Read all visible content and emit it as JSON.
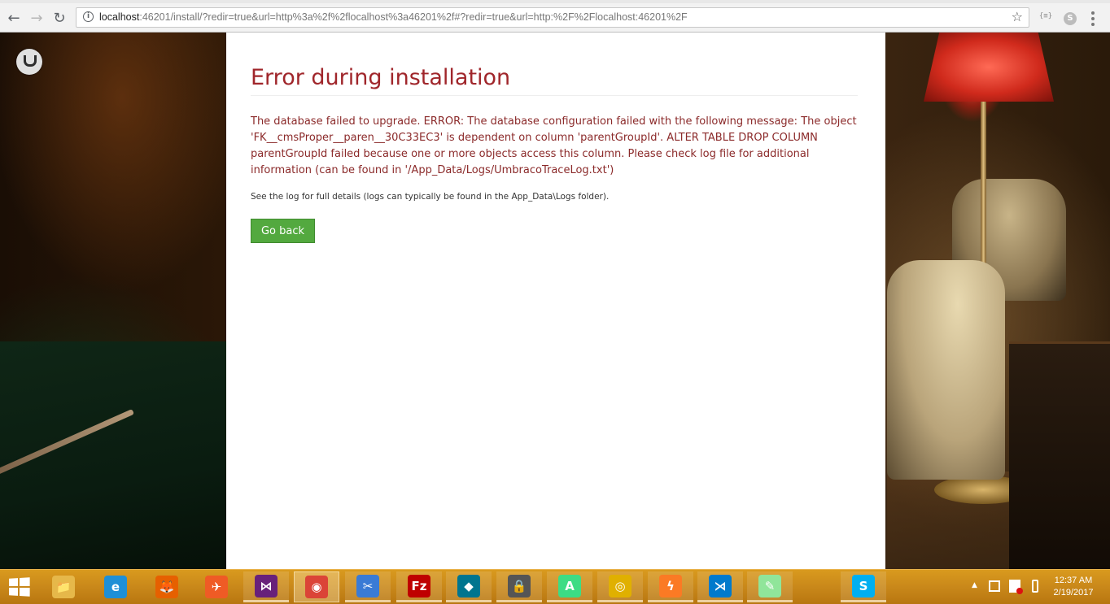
{
  "browser": {
    "url_host": "localhost",
    "url_rest": ":46201/install/?redir=true&url=http%3a%2f%2flocalhost%3a46201%2f#?redir=true&url=http:%2F%2Flocalhost:46201%2F",
    "icons": {
      "back": "arrow-left",
      "forward": "arrow-right",
      "reload": "reload",
      "info": "info",
      "bookmark": "star",
      "extensions": [
        "json-viewer",
        "skype"
      ],
      "menu": "three-dots"
    }
  },
  "page": {
    "heading": "Error during installation",
    "message": "The database failed to upgrade. ERROR: The database configuration failed with the following message: The object 'FK__cmsProper__paren__30C33EC3' is dependent on column 'parentGroupId'. ALTER TABLE DROP COLUMN parentGroupId failed because one or more objects access this column. Please check log file for additional information (can be found in '/App_Data/Logs/UmbracoTraceLog.txt')",
    "note": "See the log for full details (logs can typically be found in the App_Data\\Logs folder).",
    "go_back_label": "Go back",
    "colors": {
      "heading": "#a0262b",
      "message": "#8b2a2a",
      "button": "#53a93f"
    }
  },
  "taskbar": {
    "apps": [
      {
        "name": "file-explorer",
        "glyph": "📁",
        "color": "#e6b84a"
      },
      {
        "name": "internet-explorer",
        "glyph": "e",
        "color": "#1e8fd6"
      },
      {
        "name": "firefox",
        "glyph": "🦊",
        "color": "#e66000"
      },
      {
        "name": "postman",
        "glyph": "✈",
        "color": "#ef5b25"
      },
      {
        "name": "visual-studio",
        "glyph": "⋈",
        "color": "#68217a"
      },
      {
        "name": "chrome",
        "glyph": "◉",
        "color": "#db4437"
      },
      {
        "name": "snipping-tool",
        "glyph": "✂",
        "color": "#3a7bd5"
      },
      {
        "name": "filezilla",
        "glyph": "Fz",
        "color": "#bf0000"
      },
      {
        "name": "mysql-workbench",
        "glyph": "◆",
        "color": "#00758f"
      },
      {
        "name": "vpn-client",
        "glyph": "🔒",
        "color": "#555555"
      },
      {
        "name": "android-studio",
        "glyph": "A",
        "color": "#3ddc84"
      },
      {
        "name": "sql-utility",
        "glyph": "◎",
        "color": "#e0b000"
      },
      {
        "name": "xampp",
        "glyph": "ϟ",
        "color": "#fb7a24"
      },
      {
        "name": "vs-code",
        "glyph": "⋊",
        "color": "#007acc"
      },
      {
        "name": "notepad-plus-plus",
        "glyph": "✎",
        "color": "#90e59a"
      },
      {
        "name": "skype",
        "glyph": "S",
        "color": "#00aff0"
      }
    ],
    "time": "12:37 AM",
    "date": "2/19/2017"
  }
}
